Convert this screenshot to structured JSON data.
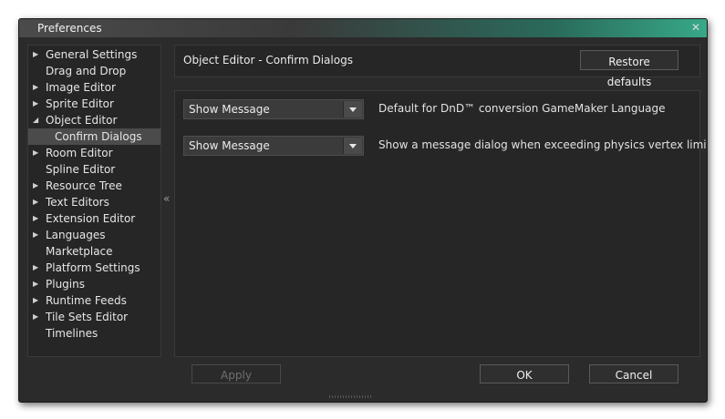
{
  "window": {
    "title": "Preferences"
  },
  "sidebar": {
    "items": [
      {
        "label": "General Settings",
        "arrow": "right"
      },
      {
        "label": "Drag and Drop",
        "arrow": ""
      },
      {
        "label": "Image Editor",
        "arrow": "right"
      },
      {
        "label": "Sprite Editor",
        "arrow": "right"
      },
      {
        "label": "Object Editor",
        "arrow": "down"
      },
      {
        "label": "Confirm Dialogs",
        "arrow": "",
        "selected": true,
        "child": true
      },
      {
        "label": "Room Editor",
        "arrow": "right"
      },
      {
        "label": "Spline Editor",
        "arrow": ""
      },
      {
        "label": "Resource Tree",
        "arrow": "right"
      },
      {
        "label": "Text Editors",
        "arrow": "right"
      },
      {
        "label": "Extension Editor",
        "arrow": "right"
      },
      {
        "label": "Languages",
        "arrow": "right"
      },
      {
        "label": "Marketplace",
        "arrow": ""
      },
      {
        "label": "Platform Settings",
        "arrow": "right"
      },
      {
        "label": "Plugins",
        "arrow": "right"
      },
      {
        "label": "Runtime Feeds",
        "arrow": "right"
      },
      {
        "label": "Tile Sets Editor",
        "arrow": "right"
      },
      {
        "label": "Timelines",
        "arrow": ""
      }
    ],
    "collapse_glyph": "«"
  },
  "header": {
    "title": "Object Editor - Confirm Dialogs",
    "restore_label": "Restore defaults"
  },
  "settings": [
    {
      "value": "Show Message",
      "description": "Default for DnD™ conversion GameMaker Language"
    },
    {
      "value": "Show Message",
      "description": "Show a message dialog when exceeding physics vertex limit"
    }
  ],
  "footer": {
    "apply_label": "Apply",
    "ok_label": "OK",
    "cancel_label": "Cancel"
  },
  "colors": {
    "accent": "#37a888",
    "window_bg": "#2b2b2b",
    "panel_bg": "#262626",
    "selected_bg": "#4b4b4b"
  }
}
